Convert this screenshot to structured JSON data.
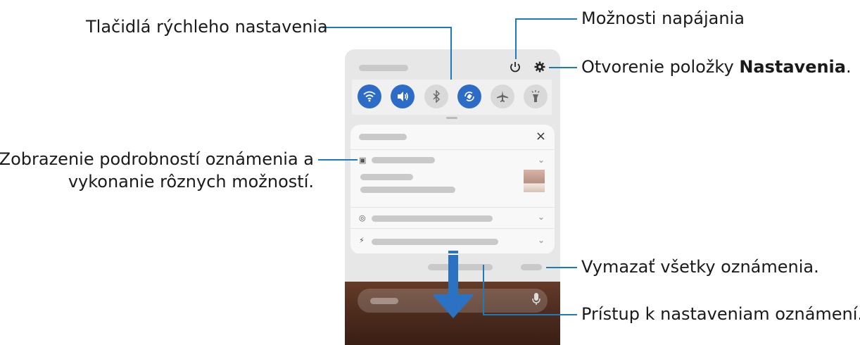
{
  "callouts": {
    "quick_settings": "Tlačidlá rýchleho nastavenia",
    "power_options": "Možnosti napájania",
    "open_settings_prefix": "Otvorenie položky ",
    "open_settings_bold": "Nastavenia",
    "open_settings_suffix": ".",
    "notif_details_line1": "Zobrazenie podrobností oznámenia a",
    "notif_details_line2": "vykonanie rôznych možností.",
    "clear_all": "Vymazať všetky oznámenia.",
    "notif_settings": "Prístup k nastaveniam oznámení."
  },
  "quick_settings_buttons": [
    {
      "icon": "wifi-icon",
      "state": "on"
    },
    {
      "icon": "sound-icon",
      "state": "on"
    },
    {
      "icon": "bluetooth-icon",
      "state": "off"
    },
    {
      "icon": "auto-rotate-icon",
      "state": "on"
    },
    {
      "icon": "airplane-mode-icon",
      "state": "off"
    },
    {
      "icon": "flashlight-icon",
      "state": "off"
    }
  ],
  "colors": {
    "accent": "#2d6cc6",
    "callout_line": "#1e7ab8",
    "arrow": "#2b73c2"
  }
}
